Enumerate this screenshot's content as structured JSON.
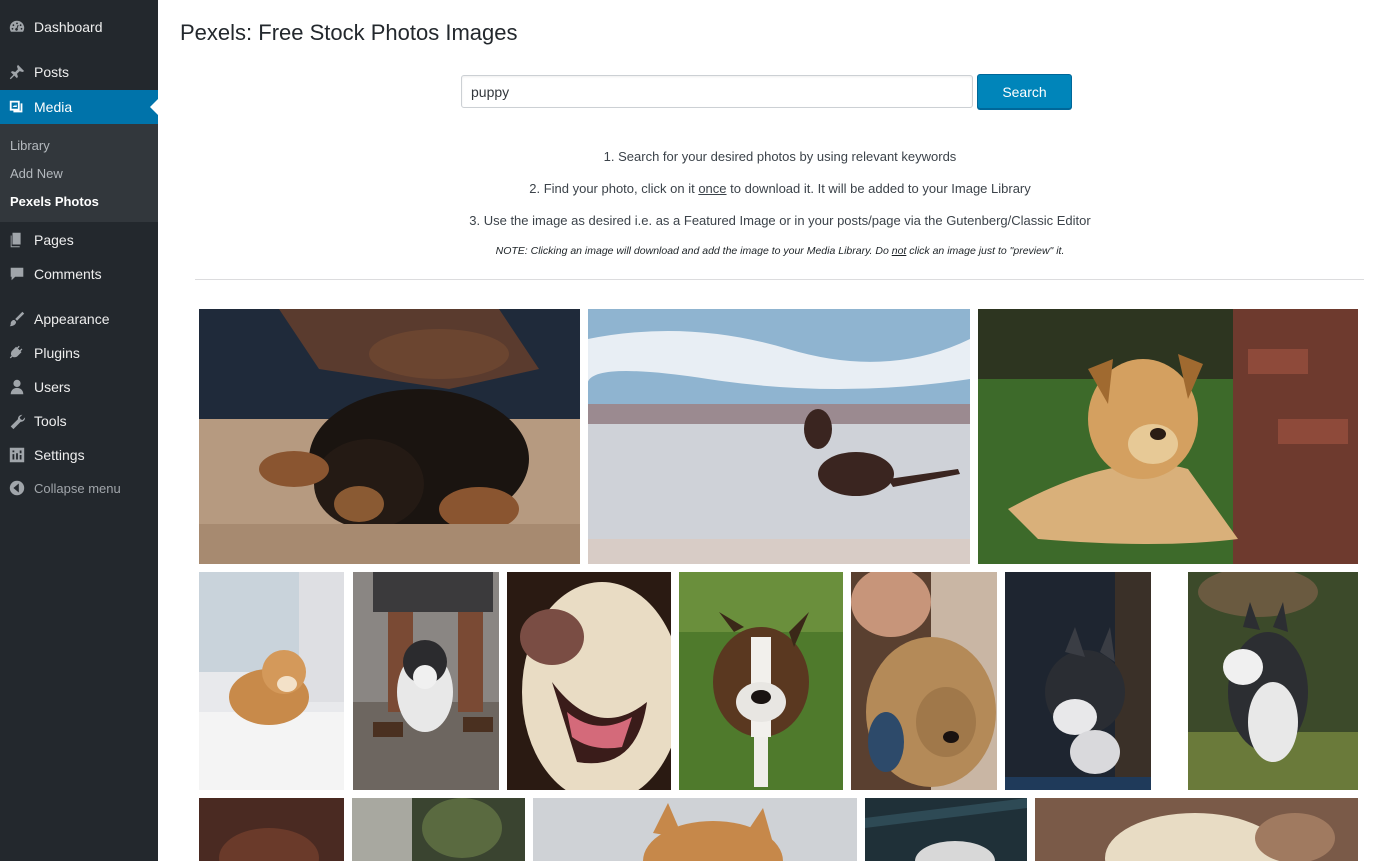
{
  "sidebar": {
    "items": [
      {
        "label": "Dashboard",
        "icon": "dashboard-icon"
      },
      {
        "label": "Posts",
        "icon": "pushpin-icon"
      },
      {
        "label": "Media",
        "icon": "media-icon"
      },
      {
        "label": "Pages",
        "icon": "pages-icon"
      },
      {
        "label": "Comments",
        "icon": "comment-icon"
      },
      {
        "label": "Appearance",
        "icon": "paintbrush-icon"
      },
      {
        "label": "Plugins",
        "icon": "plugin-icon"
      },
      {
        "label": "Users",
        "icon": "users-icon"
      },
      {
        "label": "Tools",
        "icon": "wrench-icon"
      },
      {
        "label": "Settings",
        "icon": "settings-icon"
      }
    ],
    "submenu": [
      "Library",
      "Add New",
      "Pexels Photos"
    ],
    "collapse_label": "Collapse menu",
    "accent_color": "#0073aa"
  },
  "main": {
    "title": "Pexels: Free Stock Photos Images",
    "search": {
      "value": "puppy",
      "button_label": "Search"
    },
    "instructions": {
      "step1": "1. Search for your desired photos by using relevant keywords",
      "step2_a": "2. Find your photo, click on it ",
      "step2_u": "once",
      "step2_b": " to download it. It will be added to your Image Library",
      "step3": "3. Use the image as desired i.e. as a Featured Image or in your posts/page via the Gutenberg/Classic Editor",
      "note_a": "NOTE: Clicking an image will download and add the image to your Media Library. Do ",
      "note_u": "not",
      "note_b": " click an image just to \"preview\" it."
    }
  }
}
